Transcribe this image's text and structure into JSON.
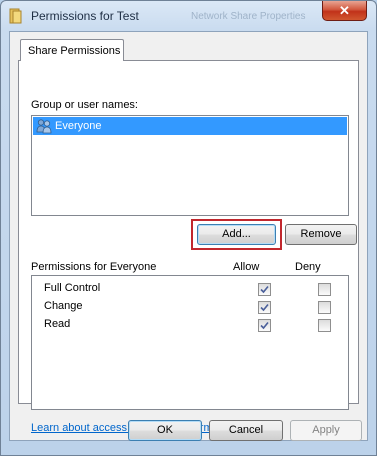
{
  "window": {
    "title": "Permissions for Test",
    "background_title": "Network Share Properties",
    "close_symbol": "✕",
    "icon": "folder-icon"
  },
  "tab": {
    "label": "Share Permissions"
  },
  "group_section": {
    "label": "Group or user names:",
    "items": [
      {
        "label": "Everyone",
        "icon": "users-icon",
        "selected": true
      }
    ]
  },
  "buttons": {
    "add": "Add...",
    "remove": "Remove"
  },
  "permissions": {
    "title": "Permissions for Everyone",
    "allow_header": "Allow",
    "deny_header": "Deny",
    "rows": [
      {
        "name": "Full Control",
        "allow": true,
        "deny": false
      },
      {
        "name": "Change",
        "allow": true,
        "deny": false
      },
      {
        "name": "Read",
        "allow": true,
        "deny": false
      }
    ]
  },
  "link": "Learn about access control and permissions",
  "footer": {
    "ok": "OK",
    "cancel": "Cancel",
    "apply": "Apply"
  },
  "colors": {
    "selection": "#3399ff",
    "highlight_box": "#c1272d",
    "link": "#0066cc"
  }
}
